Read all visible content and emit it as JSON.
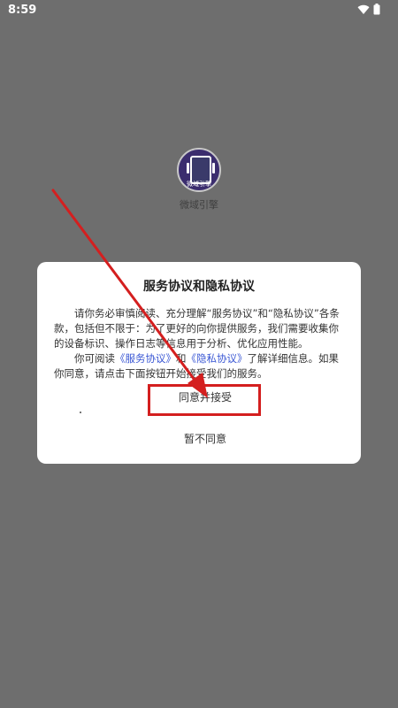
{
  "status_bar": {
    "time": "8:59",
    "icons": [
      "wifi-icon",
      "battery-icon"
    ]
  },
  "app": {
    "logo_text": "微域引擎",
    "name": "微域引擎"
  },
  "dialog": {
    "title": "服务协议和隐私协议",
    "paragraph1": "请你务必审慎阅读、充分理解“服务协议”和“隐私协议”各条款，包括但不限于：为了更好的向你提供服务，我们需要收集你的设备标识、操作日志等信息用于分析、优化应用性能。",
    "paragraph2_prefix": "你可阅读",
    "service_link": "《服务协议》",
    "and_text": "和",
    "privacy_link": "《隐私协议》",
    "paragraph2_suffix": "了解详细信息。如果你同意，请点击下面按钮开始接受我们的服务。",
    "agree_label": "同意并接受",
    "disagree_label": "暂不同意"
  },
  "colors": {
    "overlay": "#6e6e6e",
    "link": "#3a57d4",
    "annotation": "#d41f1f"
  }
}
